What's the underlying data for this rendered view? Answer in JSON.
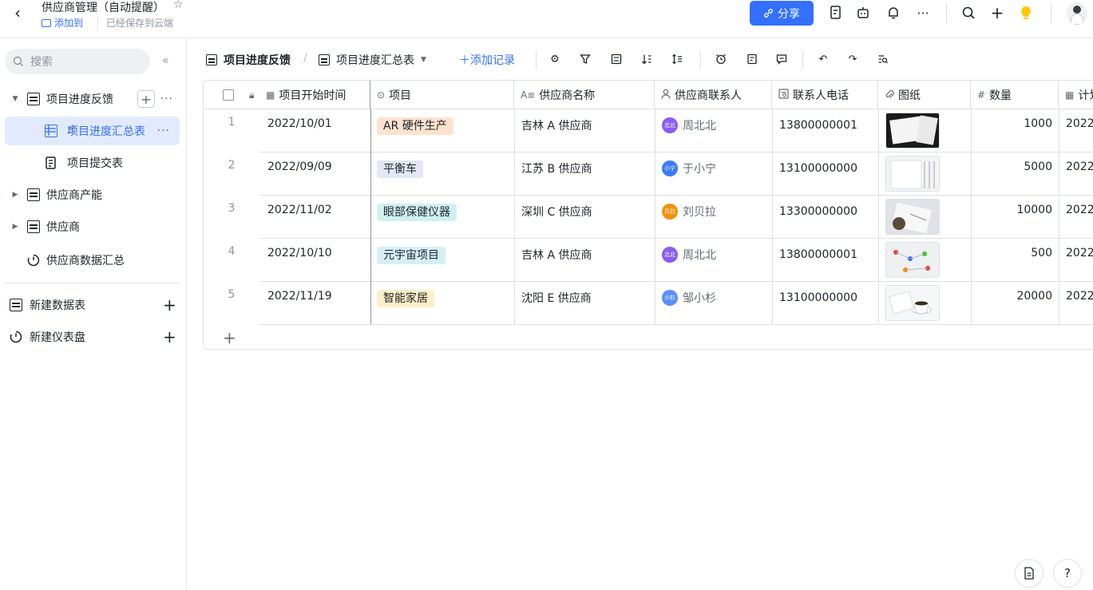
{
  "header": {
    "title": "供应商管理（自动提醒）",
    "add_to": "添加到",
    "save_status": "已经保存到云端",
    "share_label": "分享"
  },
  "sidebar": {
    "search_placeholder": "搜索",
    "items": [
      {
        "label": "项目进度反馈"
      },
      {
        "label": "项目进度汇总表"
      },
      {
        "label": "项目提交表"
      },
      {
        "label": "供应商产能"
      },
      {
        "label": "供应商"
      },
      {
        "label": "供应商数据汇总"
      }
    ],
    "new_table": "新建数据表",
    "new_dashboard": "新建仪表盘"
  },
  "toolbar": {
    "table_name": "项目进度反馈",
    "view_name": "项目进度汇总表",
    "add_record": "添加记录"
  },
  "grid": {
    "columns": [
      {
        "label": "项目开始时间"
      },
      {
        "label": "项目"
      },
      {
        "label": "供应商名称"
      },
      {
        "label": "供应商联系人"
      },
      {
        "label": "联系人电话"
      },
      {
        "label": "图纸"
      },
      {
        "label": "数量"
      },
      {
        "label": "计划"
      }
    ],
    "rows": [
      {
        "num": "1",
        "date": "2022/10/01",
        "project": "AR 硬件生产",
        "tag_color": "#fde3cf",
        "supplier": "吉林 A 供应商",
        "contact": "周北北",
        "avatar_text": "北北",
        "avatar_color": "#8a5cf5",
        "phone": "13800000001",
        "qty": "1000",
        "plan": "2022"
      },
      {
        "num": "2",
        "date": "2022/09/09",
        "project": "平衡车",
        "tag_color": "#e4e7f5",
        "supplier": "江苏 B 供应商",
        "contact": "于小宁",
        "avatar_text": "小宁",
        "avatar_color": "#3d7bfa",
        "phone": "13100000000",
        "qty": "5000",
        "plan": "2022"
      },
      {
        "num": "3",
        "date": "2022/11/02",
        "project": "眼部保健仪器",
        "tag_color": "#d0f1f1",
        "supplier": "深圳 C 供应商",
        "contact": "刘贝拉",
        "avatar_text": "贝拉",
        "avatar_color": "#f0930d",
        "phone": "13300000000",
        "qty": "10000",
        "plan": "2022"
      },
      {
        "num": "4",
        "date": "2022/10/10",
        "project": "元宇宙项目",
        "tag_color": "#d4f0f7",
        "supplier": "吉林 A 供应商",
        "contact": "周北北",
        "avatar_text": "北北",
        "avatar_color": "#8a5cf5",
        "phone": "13800000001",
        "qty": "500",
        "plan": "2022"
      },
      {
        "num": "5",
        "date": "2022/11/19",
        "project": "智能家居",
        "tag_color": "#fdefc8",
        "supplier": "沈阳 E 供应商",
        "contact": "邹小杉",
        "avatar_text": "小杉",
        "avatar_color": "#5b8ff9",
        "phone": "13100000000",
        "qty": "20000",
        "plan": "2022"
      }
    ]
  }
}
